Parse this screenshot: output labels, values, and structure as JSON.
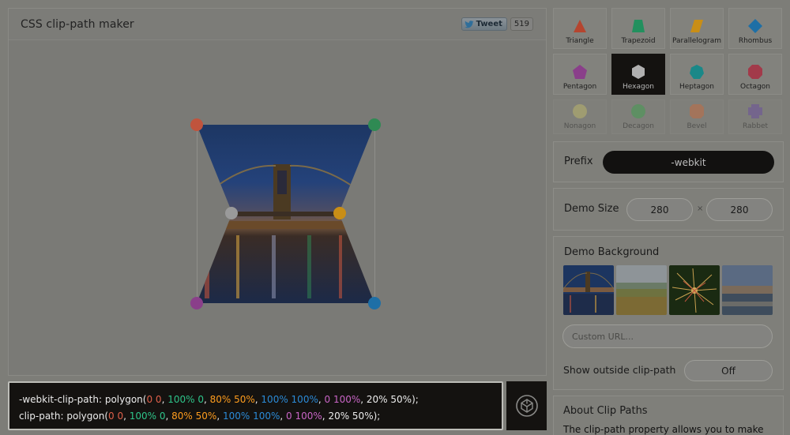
{
  "header": {
    "title": "CSS clip-path maker",
    "tweet_label": "Tweet",
    "tweet_count": "519"
  },
  "shapes": [
    {
      "label": "Triangle",
      "icon": "triangle-icon",
      "color": "#b5452f",
      "state": "normal"
    },
    {
      "label": "Trapezoid",
      "icon": "trapezoid-icon",
      "color": "#22905e",
      "state": "normal"
    },
    {
      "label": "Parallelogram",
      "icon": "parallelogram-icon",
      "color": "#c98e16",
      "state": "normal"
    },
    {
      "label": "Rhombus",
      "icon": "rhombus-icon",
      "color": "#1e6fa6",
      "state": "normal"
    },
    {
      "label": "Pentagon",
      "icon": "pentagon-icon",
      "color": "#8a3f8a",
      "state": "normal"
    },
    {
      "label": "Hexagon",
      "icon": "hexagon-icon",
      "color": "#b0b0b0",
      "state": "active"
    },
    {
      "label": "Heptagon",
      "icon": "heptagon-icon",
      "color": "#1a8888",
      "state": "normal"
    },
    {
      "label": "Octagon",
      "icon": "octagon-icon",
      "color": "#a23a4a",
      "state": "normal"
    },
    {
      "label": "Nonagon",
      "icon": "nonagon-icon",
      "color": "#c9c26a",
      "state": "faded"
    },
    {
      "label": "Decagon",
      "icon": "decagon-icon",
      "color": "#3aa64a",
      "state": "faded"
    },
    {
      "label": "Bevel",
      "icon": "bevel-icon",
      "color": "#d36a3a",
      "state": "faded"
    },
    {
      "label": "Rabbet",
      "icon": "rabbet-icon",
      "color": "#6a4aa6",
      "state": "faded"
    }
  ],
  "prefix": {
    "label": "Prefix",
    "value": "-webkit"
  },
  "demo_size": {
    "label": "Demo Size",
    "width": "280",
    "separator": "×",
    "height": "280"
  },
  "demo_background": {
    "label": "Demo Background",
    "thumbnails": [
      "bridge-night-thumbnail",
      "field-thumbnail",
      "fireworks-thumbnail",
      "beach-thumbnail"
    ],
    "custom_url_placeholder": "Custom URL..."
  },
  "outside": {
    "label": "Show outside clip-path",
    "value": "Off"
  },
  "about": {
    "title": "About Clip Paths",
    "text": "The clip-path property allows you to make"
  },
  "code": {
    "webkit_prop": "-webkit-clip-path: ",
    "prop": "clip-path: ",
    "open": "polygon(",
    "p1": "0 0",
    "p2": "100% 0",
    "p3": "80% 50%",
    "p4": "100% 100%",
    "p5": "0 100%",
    "p6": "20% 50%",
    "sep": ", ",
    "close": ");"
  },
  "colors": {
    "handle_red": "#c0543d",
    "handle_green": "#2f8a53",
    "handle_orange": "#c98e16",
    "handle_blue": "#1e6fa6",
    "handle_purple": "#8a3f8a",
    "handle_gray": "#9a9a9a"
  },
  "codepen_icon": "codepen-icon"
}
